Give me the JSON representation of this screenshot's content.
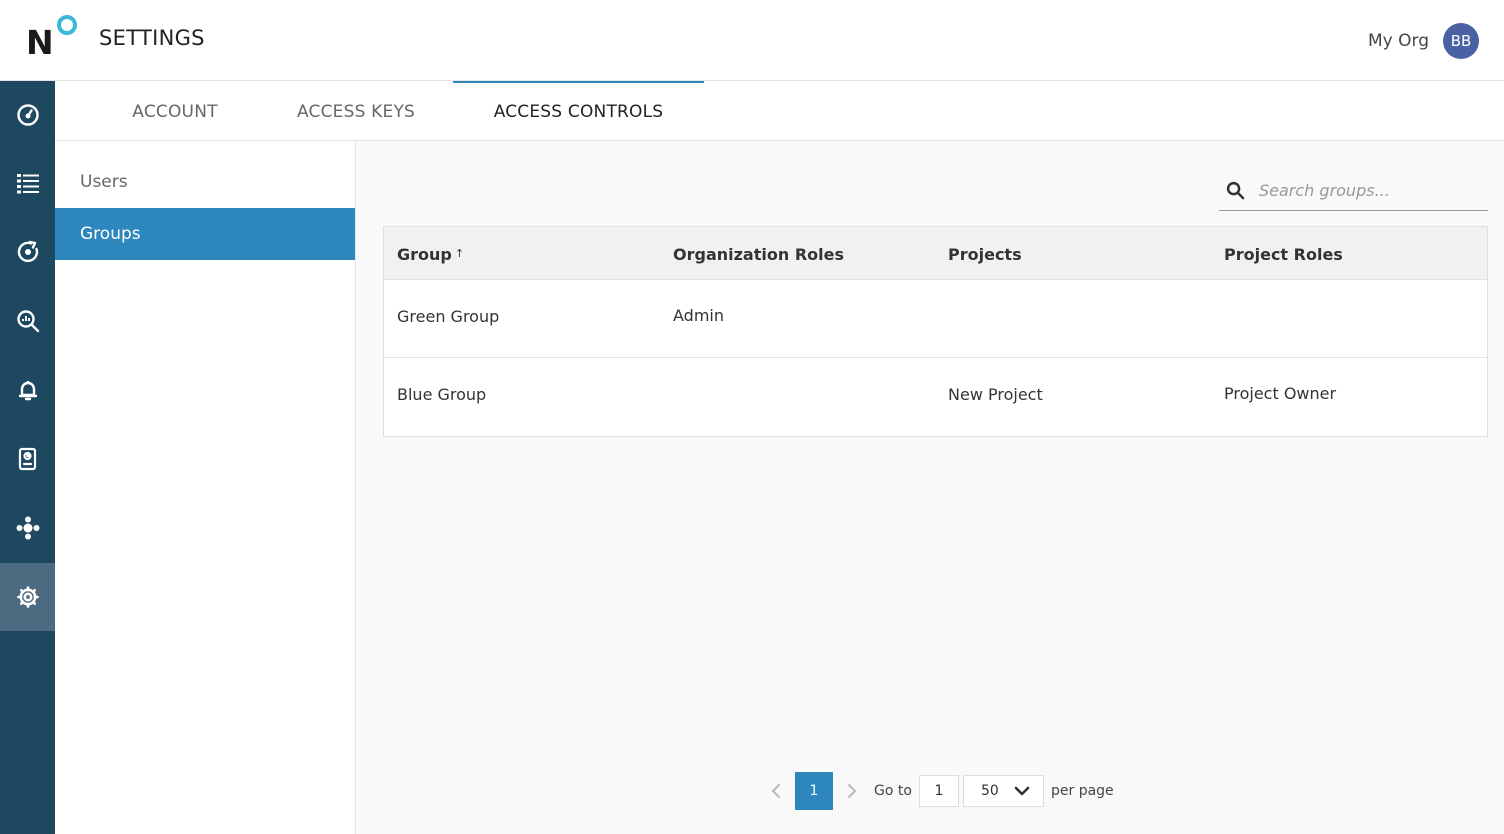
{
  "header": {
    "title": "SETTINGS",
    "org_name": "My Org",
    "avatar_initials": "BB"
  },
  "rail": {
    "items": [
      {
        "icon": "dashboard-gauge-icon"
      },
      {
        "icon": "list-icon"
      },
      {
        "icon": "target-refresh-icon"
      },
      {
        "icon": "search-analytics-icon"
      },
      {
        "icon": "bell-icon"
      },
      {
        "icon": "report-document-icon"
      },
      {
        "icon": "integrations-icon"
      },
      {
        "icon": "settings-gear-icon",
        "active": true
      }
    ]
  },
  "tabs": [
    {
      "label": "ACCOUNT"
    },
    {
      "label": "ACCESS KEYS"
    },
    {
      "label": "ACCESS CONTROLS",
      "active": true
    }
  ],
  "subnav": [
    {
      "label": "Users"
    },
    {
      "label": "Groups",
      "active": true
    }
  ],
  "search": {
    "placeholder": "Search groups..."
  },
  "table": {
    "columns": [
      "Group",
      "Organization Roles",
      "Projects",
      "Project Roles"
    ],
    "sort_indicator": "↑",
    "rows": [
      {
        "group": "Green Group",
        "org_roles": "Admin",
        "projects": "",
        "project_roles": ""
      },
      {
        "group": "Blue Group",
        "org_roles": "",
        "projects": "New Project",
        "project_roles": "Project Owner"
      }
    ]
  },
  "pagination": {
    "current_page": "1",
    "goto_label": "Go to",
    "goto_value": "1",
    "page_size": "50",
    "per_page_label": "per page"
  },
  "colors": {
    "rail_bg": "#1e4760",
    "rail_active": "#4c6a80",
    "accent": "#2d87bd",
    "avatar": "#4a62a4",
    "logo_ring": "#3db8d4"
  }
}
